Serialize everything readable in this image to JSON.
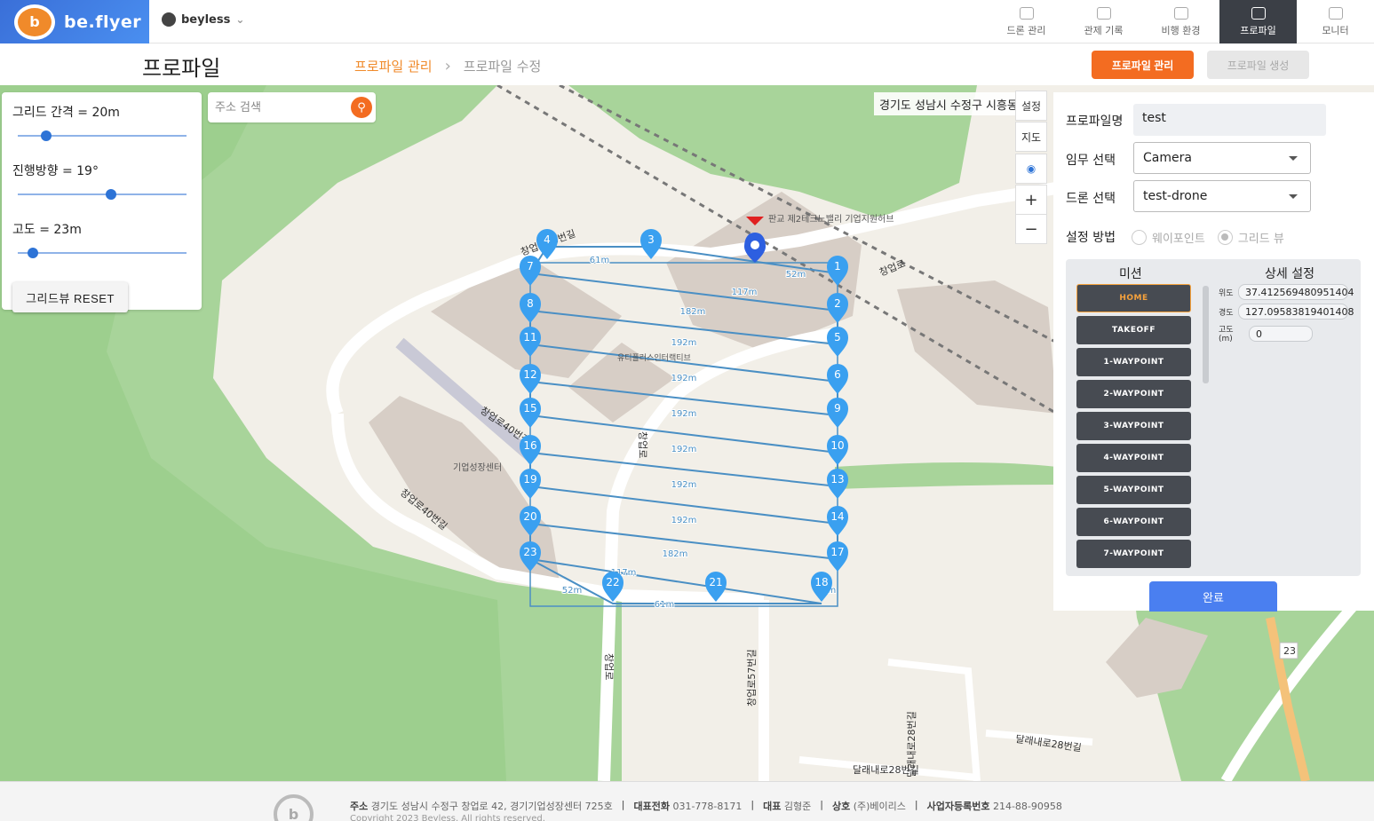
{
  "brand": {
    "name": "be.flyer",
    "logo_letter": "b"
  },
  "org": {
    "name": "beyless"
  },
  "nav": [
    {
      "label": "드론 관리",
      "icon": "drone-icon"
    },
    {
      "label": "관제 기록",
      "icon": "layers-icon"
    },
    {
      "label": "비행 환경",
      "icon": "no-fly-icon"
    },
    {
      "label": "프로파일",
      "icon": "map-pin-icon",
      "active": true
    },
    {
      "label": "모니터",
      "icon": "radar-icon"
    }
  ],
  "page": {
    "title": "프로파일",
    "crumb_current": "프로파일 관리",
    "crumb_next": "프로파일 수정",
    "btn_manage": "프로파일 관리",
    "btn_create": "프로파일 생성"
  },
  "grid_panel": {
    "spacing_label": "그리드 간격 = 20m",
    "heading_label": "진행방향 = 19°",
    "altitude_label": "고도 = 23m",
    "spacing_fraction": 0.17,
    "heading_fraction": 0.55,
    "altitude_fraction": 0.09,
    "reset_label": "그리드뷰 RESET"
  },
  "search": {
    "placeholder": "주소 검색"
  },
  "map": {
    "address": "경기도 성남시 수정구 시흥동",
    "ctrl_settings": "설정",
    "ctrl_map": "지도",
    "zoom_in": "+",
    "zoom_out": "−",
    "labels": {
      "road1": "창업로40번길",
      "road2": "창업로40번길",
      "road3": "창업로",
      "road4": "창업로",
      "road5": "창업로57번길",
      "road6": "달래내로28번길",
      "road7": "달래내로28번길",
      "road8": "달래내로28번길",
      "bld1": "판교 제2테크노밸리 기업지원허브",
      "bld2": "기업성장센터",
      "bld3": "유티플러스인터랙티브",
      "road9": "창업로",
      "route_num": "23"
    },
    "distance_labels": [
      "61m",
      "117m",
      "182m",
      "192m",
      "192m",
      "192m",
      "192m",
      "192m",
      "192m",
      "182m",
      "117m",
      "52m",
      "61m",
      "52m",
      "20m"
    ],
    "waypoints": [
      "1",
      "2",
      "3",
      "4",
      "5",
      "6",
      "7",
      "8",
      "9",
      "10",
      "11",
      "12",
      "13",
      "14",
      "15",
      "16",
      "17",
      "18",
      "19",
      "20",
      "21",
      "22",
      "23"
    ]
  },
  "right_panel": {
    "name_label": "프로파일명",
    "name_value": "test",
    "mission_label": "임무 선택",
    "mission_value": "Camera",
    "drone_label": "드론 선택",
    "drone_value": "test-drone",
    "method_label": "설정 방법",
    "method_waypoint": "웨이포인트",
    "method_grid": "그리드 뷰",
    "mission_header": "미션",
    "detail_header": "상세 설정",
    "missions": [
      "HOME",
      "TAKEOFF",
      "1-WAYPOINT",
      "2-WAYPOINT",
      "3-WAYPOINT",
      "4-WAYPOINT",
      "5-WAYPOINT",
      "6-WAYPOINT",
      "7-WAYPOINT"
    ],
    "lat_label": "위도",
    "lat_value": "37.412569480951404",
    "lng_label": "경도",
    "lng_value": "127.09583819401408",
    "alt_label": "고도(m)",
    "alt_value": "0",
    "done_label": "완료"
  },
  "footer": {
    "addr_label": "주소",
    "addr_value": "경기도 성남시 수정구 창업로 42, 경기기업성장센터 725호",
    "tel_label": "대표전화",
    "tel_value": "031-778-8171",
    "ceo_label": "대표",
    "ceo_value": "김형준",
    "company_label": "상호",
    "company_value": "(주)베이리스",
    "biz_label": "사업자등록번호",
    "biz_value": "214-88-90958",
    "copyright": "Copyright 2023 Beyless. All rights reserved."
  },
  "colors": {
    "accent": "#f36c21",
    "nav_active": "#3b3f46",
    "primary": "#4a7ff0",
    "route": "#4a8fc4",
    "pin": "#3aa0f0"
  }
}
